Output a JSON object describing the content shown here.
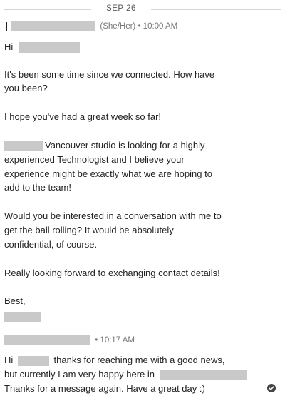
{
  "date_divider": "SEP 26",
  "message1": {
    "sender_meta": "(She/Her) • 10:00 AM",
    "greeting": "Hi",
    "p1_line1": "It's been some time since we connected. How have",
    "p1_line2": "you been?",
    "p2": "I hope you've had a great week so far!",
    "p3_line1": "Vancouver studio is looking for a highly",
    "p3_line2": "experienced Technologist and I believe your",
    "p3_line3": "experience might be exactly what we are hoping to",
    "p3_line4": "add to the team!",
    "p4_line1": "Would you be interested in a conversation with me to",
    "p4_line2": "get the ball rolling? It would be absolutely",
    "p4_line3": "confidential, of course.",
    "p5": "Really looking forward to exchanging contact details!",
    "signoff": "Best,"
  },
  "message2": {
    "sender_meta": "• 10:17 AM",
    "line1_start": "Hi",
    "line1_end": "thanks for reaching me with a good news,",
    "line2": "but currently I am very happy here in",
    "line3": "Thanks for a message again. Have a great day :)",
    "status_icon": "check-circle-icon"
  },
  "colors": {
    "redaction": "#c9c9c9",
    "text": "#222222",
    "meta": "#777777"
  }
}
